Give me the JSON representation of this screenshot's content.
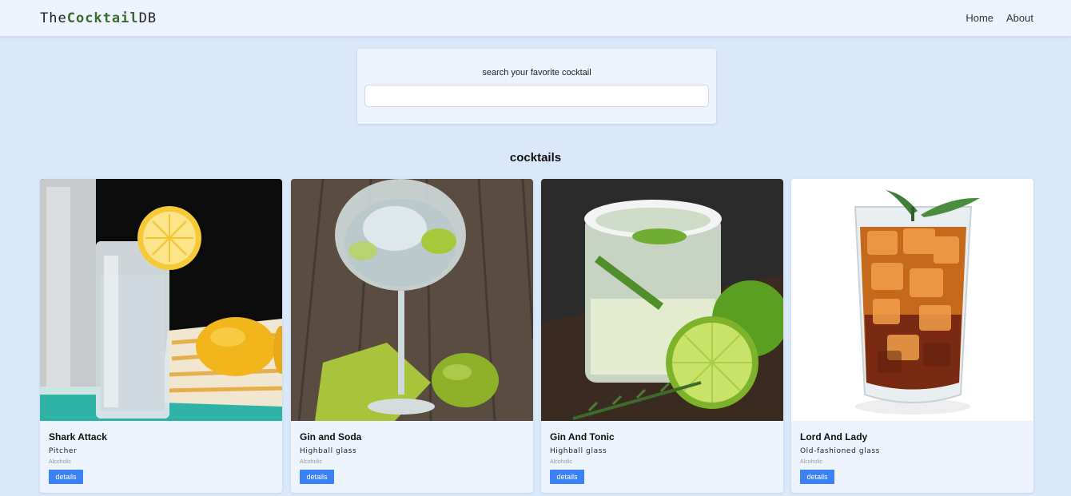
{
  "brand": {
    "prefix": "The",
    "accent": "Cocktail",
    "suffix": "DB"
  },
  "nav": {
    "home": "Home",
    "about": "About"
  },
  "search": {
    "label": "search your favorite cocktail",
    "value": "",
    "placeholder": ""
  },
  "section_title": "cocktails",
  "cocktails": [
    {
      "name": "Shark Attack",
      "glass": "Pitcher",
      "type": "Alcoholic",
      "button": "details"
    },
    {
      "name": "Gin and Soda",
      "glass": "Highball glass",
      "type": "Alcoholic",
      "button": "details"
    },
    {
      "name": "Gin And Tonic",
      "glass": "Highball glass",
      "type": "Alcoholic",
      "button": "details"
    },
    {
      "name": "Lord And Lady",
      "glass": "Old-fashioned glass",
      "type": "Alcoholic",
      "button": "details"
    }
  ],
  "colors": {
    "background": "#dae8fc",
    "surface": "#eef4fd",
    "accent": "#3b6b2a",
    "button": "#3b82f6"
  }
}
